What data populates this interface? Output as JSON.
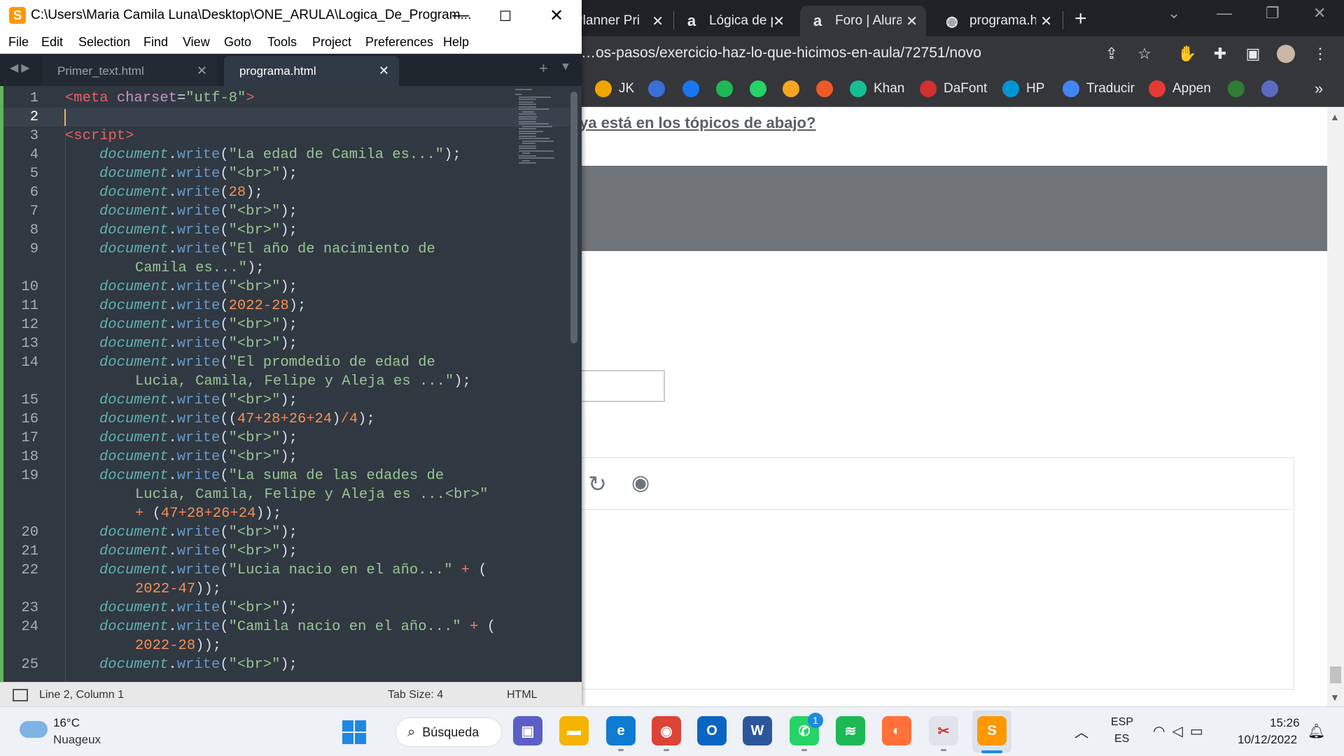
{
  "browser": {
    "tabs": [
      {
        "title": "Planner Pri",
        "active": false
      },
      {
        "title": "Lógica de p",
        "active": false
      },
      {
        "title": "Foro | Alura",
        "active": true
      },
      {
        "title": "programa.h",
        "active": false
      }
    ],
    "url": "…os-pasos/exercicio-haz-lo-que-hicimos-en-aula/72751/novo",
    "bookmarks": [
      {
        "label": "JK",
        "color": "#f0a500"
      },
      {
        "label": "",
        "color": "#3a6fd8"
      },
      {
        "label": "",
        "color": "#1877f2"
      },
      {
        "label": "",
        "color": "#1db954"
      },
      {
        "label": "",
        "color": "#25d366"
      },
      {
        "label": "",
        "color": "#f5a623"
      },
      {
        "label": "",
        "color": "#f05a28"
      },
      {
        "label": "Khan",
        "color": "#14bf96"
      },
      {
        "label": "DaFont",
        "color": "#d32f2f"
      },
      {
        "label": "HP",
        "color": "#0096d6"
      },
      {
        "label": "Traducir",
        "color": "#4285f4"
      },
      {
        "label": "Appen",
        "color": "#e53935"
      },
      {
        "label": "",
        "color": "#2e7d32"
      },
      {
        "label": "",
        "color": "#5c6bc0"
      }
    ],
    "page_question_link": "ya está en los tópicos de abajo?"
  },
  "sublime": {
    "title": "C:\\Users\\Maria Camila Luna\\Desktop\\ONE_ARULA\\Logica_De_Program...",
    "menu": [
      "File",
      "Edit",
      "Selection",
      "Find",
      "View",
      "Goto",
      "Tools",
      "Project",
      "Preferences",
      "Help"
    ],
    "tabs": [
      {
        "label": "Primer_text.html",
        "active": false
      },
      {
        "label": "programa.html",
        "active": true
      }
    ],
    "status": {
      "position": "Line 2, Column 1",
      "tab_size": "Tab Size: 4",
      "syntax": "HTML"
    },
    "current_line": 2
  },
  "code_lines": [
    {
      "n": "1",
      "indent": 0,
      "tokens": [
        [
          "tag",
          "<meta "
        ],
        [
          "attr",
          "charset"
        ],
        [
          "pun",
          "="
        ],
        [
          "str",
          "\"utf-8\""
        ],
        [
          "tag",
          ">"
        ]
      ]
    },
    {
      "n": "2",
      "indent": 0,
      "tokens": []
    },
    {
      "n": "3",
      "indent": 0,
      "tokens": [
        [
          "tag",
          "<script>"
        ]
      ]
    },
    {
      "n": "4",
      "indent": 1,
      "tokens": [
        [
          "kw",
          "document"
        ],
        [
          "pun",
          "."
        ],
        [
          "fn",
          "write"
        ],
        [
          "pun",
          "("
        ],
        [
          "str",
          "\"La edad de Camila es...\""
        ],
        [
          "pun",
          ");"
        ]
      ]
    },
    {
      "n": "5",
      "indent": 1,
      "tokens": [
        [
          "kw",
          "document"
        ],
        [
          "pun",
          "."
        ],
        [
          "fn",
          "write"
        ],
        [
          "pun",
          "("
        ],
        [
          "str",
          "\"<br>\""
        ],
        [
          "pun",
          ");"
        ]
      ]
    },
    {
      "n": "6",
      "indent": 1,
      "tokens": [
        [
          "kw",
          "document"
        ],
        [
          "pun",
          "."
        ],
        [
          "fn",
          "write"
        ],
        [
          "pun",
          "("
        ],
        [
          "num",
          "28"
        ],
        [
          "pun",
          ");"
        ]
      ]
    },
    {
      "n": "7",
      "indent": 1,
      "tokens": [
        [
          "kw",
          "document"
        ],
        [
          "pun",
          "."
        ],
        [
          "fn",
          "write"
        ],
        [
          "pun",
          "("
        ],
        [
          "str",
          "\"<br>\""
        ],
        [
          "pun",
          ");"
        ]
      ]
    },
    {
      "n": "8",
      "indent": 1,
      "tokens": [
        [
          "kw",
          "document"
        ],
        [
          "pun",
          "."
        ],
        [
          "fn",
          "write"
        ],
        [
          "pun",
          "("
        ],
        [
          "str",
          "\"<br>\""
        ],
        [
          "pun",
          ");"
        ]
      ]
    },
    {
      "n": "9",
      "indent": 1,
      "tokens": [
        [
          "kw",
          "document"
        ],
        [
          "pun",
          "."
        ],
        [
          "fn",
          "write"
        ],
        [
          "pun",
          "("
        ],
        [
          "str",
          "\"El año de nacimiento de"
        ]
      ]
    },
    {
      "n": "",
      "indent": 2,
      "tokens": [
        [
          "str",
          "Camila es...\""
        ],
        [
          "pun",
          ");"
        ]
      ]
    },
    {
      "n": "10",
      "indent": 1,
      "tokens": [
        [
          "kw",
          "document"
        ],
        [
          "pun",
          "."
        ],
        [
          "fn",
          "write"
        ],
        [
          "pun",
          "("
        ],
        [
          "str",
          "\"<br>\""
        ],
        [
          "pun",
          ");"
        ]
      ]
    },
    {
      "n": "11",
      "indent": 1,
      "tokens": [
        [
          "kw",
          "document"
        ],
        [
          "pun",
          "."
        ],
        [
          "fn",
          "write"
        ],
        [
          "pun",
          "("
        ],
        [
          "num",
          "2022"
        ],
        [
          "op",
          "-"
        ],
        [
          "num",
          "28"
        ],
        [
          "pun",
          ");"
        ]
      ]
    },
    {
      "n": "12",
      "indent": 1,
      "tokens": [
        [
          "kw",
          "document"
        ],
        [
          "pun",
          "."
        ],
        [
          "fn",
          "write"
        ],
        [
          "pun",
          "("
        ],
        [
          "str",
          "\"<br>\""
        ],
        [
          "pun",
          ");"
        ]
      ]
    },
    {
      "n": "13",
      "indent": 1,
      "tokens": [
        [
          "kw",
          "document"
        ],
        [
          "pun",
          "."
        ],
        [
          "fn",
          "write"
        ],
        [
          "pun",
          "("
        ],
        [
          "str",
          "\"<br>\""
        ],
        [
          "pun",
          ");"
        ]
      ]
    },
    {
      "n": "14",
      "indent": 1,
      "tokens": [
        [
          "kw",
          "document"
        ],
        [
          "pun",
          "."
        ],
        [
          "fn",
          "write"
        ],
        [
          "pun",
          "("
        ],
        [
          "str",
          "\"El promdedio de edad de"
        ]
      ]
    },
    {
      "n": "",
      "indent": 2,
      "tokens": [
        [
          "str",
          "Lucia, Camila, Felipe y Aleja es ...\""
        ],
        [
          "pun",
          ");"
        ]
      ]
    },
    {
      "n": "15",
      "indent": 1,
      "tokens": [
        [
          "kw",
          "document"
        ],
        [
          "pun",
          "."
        ],
        [
          "fn",
          "write"
        ],
        [
          "pun",
          "("
        ],
        [
          "str",
          "\"<br>\""
        ],
        [
          "pun",
          ");"
        ]
      ]
    },
    {
      "n": "16",
      "indent": 1,
      "tokens": [
        [
          "kw",
          "document"
        ],
        [
          "pun",
          "."
        ],
        [
          "fn",
          "write"
        ],
        [
          "pun",
          "(("
        ],
        [
          "num",
          "47"
        ],
        [
          "op",
          "+"
        ],
        [
          "num",
          "28"
        ],
        [
          "op",
          "+"
        ],
        [
          "num",
          "26"
        ],
        [
          "op",
          "+"
        ],
        [
          "num",
          "24"
        ],
        [
          "pun",
          ")"
        ],
        [
          "op",
          "/"
        ],
        [
          "num",
          "4"
        ],
        [
          "pun",
          ");"
        ]
      ]
    },
    {
      "n": "17",
      "indent": 1,
      "tokens": [
        [
          "kw",
          "document"
        ],
        [
          "pun",
          "."
        ],
        [
          "fn",
          "write"
        ],
        [
          "pun",
          "("
        ],
        [
          "str",
          "\"<br>\""
        ],
        [
          "pun",
          ");"
        ]
      ]
    },
    {
      "n": "18",
      "indent": 1,
      "tokens": [
        [
          "kw",
          "document"
        ],
        [
          "pun",
          "."
        ],
        [
          "fn",
          "write"
        ],
        [
          "pun",
          "("
        ],
        [
          "str",
          "\"<br>\""
        ],
        [
          "pun",
          ");"
        ]
      ]
    },
    {
      "n": "19",
      "indent": 1,
      "tokens": [
        [
          "kw",
          "document"
        ],
        [
          "pun",
          "."
        ],
        [
          "fn",
          "write"
        ],
        [
          "pun",
          "("
        ],
        [
          "str",
          "\"La suma de las edades de"
        ]
      ]
    },
    {
      "n": "",
      "indent": 2,
      "tokens": [
        [
          "str",
          "Lucia, Camila, Felipe y Aleja es ...<br>\""
        ]
      ]
    },
    {
      "n": "",
      "indent": 2,
      "tokens": [
        [
          "op",
          "+"
        ],
        [
          "pun",
          " ("
        ],
        [
          "num",
          "47"
        ],
        [
          "op",
          "+"
        ],
        [
          "num",
          "28"
        ],
        [
          "op",
          "+"
        ],
        [
          "num",
          "26"
        ],
        [
          "op",
          "+"
        ],
        [
          "num",
          "24"
        ],
        [
          "pun",
          "));"
        ]
      ]
    },
    {
      "n": "20",
      "indent": 1,
      "tokens": [
        [
          "kw",
          "document"
        ],
        [
          "pun",
          "."
        ],
        [
          "fn",
          "write"
        ],
        [
          "pun",
          "("
        ],
        [
          "str",
          "\"<br>\""
        ],
        [
          "pun",
          ");"
        ]
      ]
    },
    {
      "n": "21",
      "indent": 1,
      "tokens": [
        [
          "kw",
          "document"
        ],
        [
          "pun",
          "."
        ],
        [
          "fn",
          "write"
        ],
        [
          "pun",
          "("
        ],
        [
          "str",
          "\"<br>\""
        ],
        [
          "pun",
          ");"
        ]
      ]
    },
    {
      "n": "22",
      "indent": 1,
      "tokens": [
        [
          "kw",
          "document"
        ],
        [
          "pun",
          "."
        ],
        [
          "fn",
          "write"
        ],
        [
          "pun",
          "("
        ],
        [
          "str",
          "\"Lucia nacio en el año...\""
        ],
        [
          "op",
          " + "
        ],
        [
          "pun",
          "("
        ]
      ]
    },
    {
      "n": "",
      "indent": 2,
      "tokens": [
        [
          "num",
          "2022"
        ],
        [
          "op",
          "-"
        ],
        [
          "num",
          "47"
        ],
        [
          "pun",
          "));"
        ]
      ]
    },
    {
      "n": "23",
      "indent": 1,
      "tokens": [
        [
          "kw",
          "document"
        ],
        [
          "pun",
          "."
        ],
        [
          "fn",
          "write"
        ],
        [
          "pun",
          "("
        ],
        [
          "str",
          "\"<br>\""
        ],
        [
          "pun",
          ");"
        ]
      ]
    },
    {
      "n": "24",
      "indent": 1,
      "tokens": [
        [
          "kw",
          "document"
        ],
        [
          "pun",
          "."
        ],
        [
          "fn",
          "write"
        ],
        [
          "pun",
          "("
        ],
        [
          "str",
          "\"Camila nacio en el año...\""
        ],
        [
          "op",
          " + "
        ],
        [
          "pun",
          "("
        ]
      ]
    },
    {
      "n": "",
      "indent": 2,
      "tokens": [
        [
          "num",
          "2022"
        ],
        [
          "op",
          "-"
        ],
        [
          "num",
          "28"
        ],
        [
          "pun",
          "));"
        ]
      ]
    },
    {
      "n": "25",
      "indent": 1,
      "tokens": [
        [
          "kw",
          "document"
        ],
        [
          "pun",
          "."
        ],
        [
          "fn",
          "write"
        ],
        [
          "pun",
          "("
        ],
        [
          "str",
          "\"<br>\""
        ],
        [
          "pun",
          ");"
        ]
      ]
    }
  ],
  "taskbar": {
    "weather_temp": "16°C",
    "weather_desc": "Nuageux",
    "search_label": "Búsqueda",
    "apps": [
      {
        "name": "teams-chat-icon",
        "color": "#5b5fc7",
        "glyph": "▣"
      },
      {
        "name": "file-explorer-icon",
        "color": "#f4b400",
        "glyph": "▬"
      },
      {
        "name": "edge-icon",
        "color": "#0f7bd1",
        "glyph": "e"
      },
      {
        "name": "chrome-icon",
        "color": "#db4437",
        "glyph": "◉"
      },
      {
        "name": "outlook-icon",
        "color": "#0a64c2",
        "glyph": "O"
      },
      {
        "name": "word-icon",
        "color": "#2b579a",
        "glyph": "W"
      },
      {
        "name": "whatsapp-icon",
        "color": "#25d366",
        "glyph": "✆"
      },
      {
        "name": "spotify-icon",
        "color": "#1db954",
        "glyph": "≋"
      },
      {
        "name": "firefox-icon",
        "color": "#ff7139",
        "glyph": "◐"
      },
      {
        "name": "snipping-tool-icon",
        "color": "#e0e3ea",
        "glyph": "✂"
      },
      {
        "name": "sublime-text-icon",
        "color": "#ff9800",
        "glyph": "S"
      }
    ],
    "whatsapp_badge": "1",
    "lang_line1": "ESP",
    "lang_line2": "ES",
    "clock_time": "15:26",
    "clock_date": "10/12/2022"
  }
}
